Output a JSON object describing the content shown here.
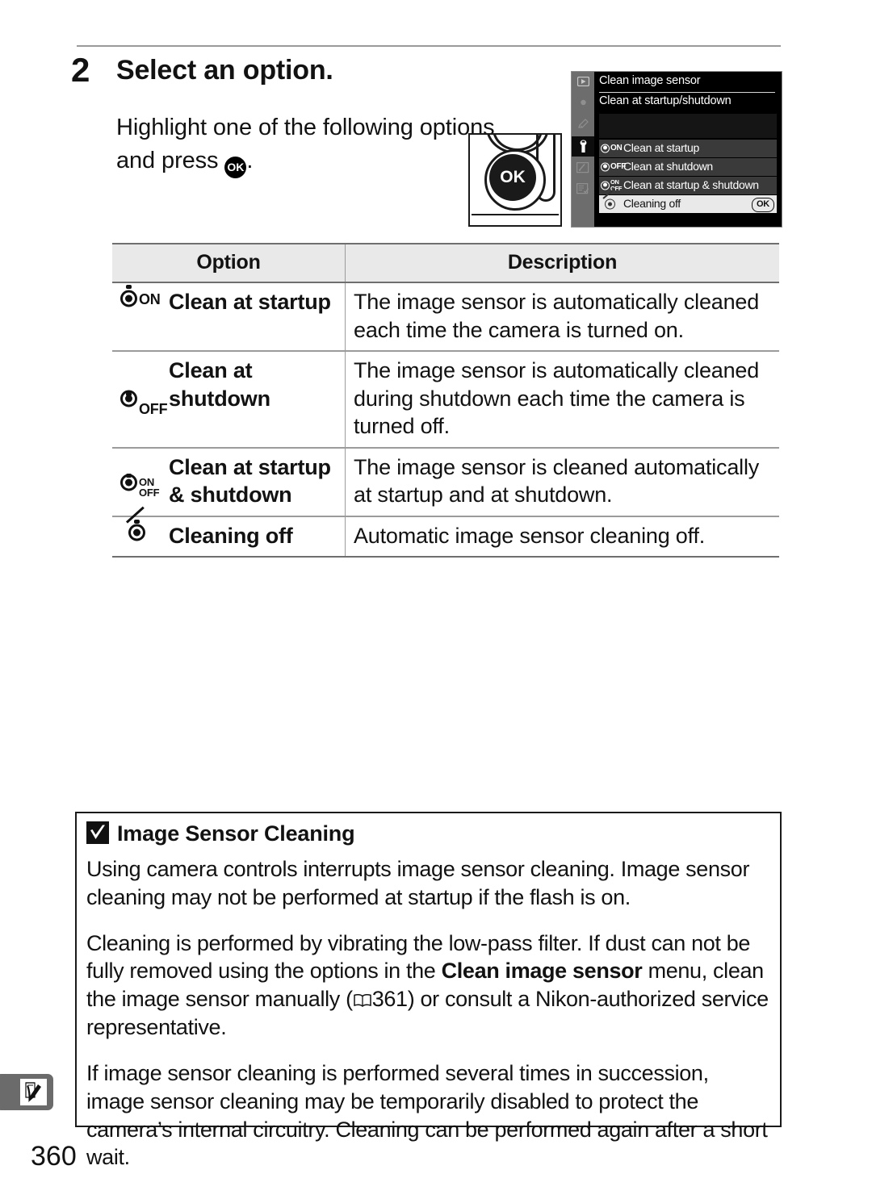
{
  "page": {
    "number": "360",
    "side_tab_icon": "setup-menu-pencil-icon"
  },
  "step": {
    "number": "2",
    "title": "Select an option.",
    "body_before": "Highlight one of the following options and press ",
    "body_icon": "ok-button-icon",
    "body_after": "."
  },
  "camera_illustration": {
    "button_label": "OK",
    "icon_name": "camera-multi-selector-ok-button"
  },
  "lcd": {
    "title": "Clean image sensor",
    "subtitle": "Clean at startup/shutdown",
    "sidebar_icons": [
      "playback-menu-icon",
      "shooting-menu-icon",
      "custom-settings-pencil-icon",
      "setup-menu-wrench-icon",
      "retouch-menu-icon",
      "recent-settings-icon"
    ],
    "sidebar_active_index": 3,
    "rows": [
      {
        "icon": "clean-at-startup-icon",
        "icon_text": "ON",
        "label": "Clean at startup",
        "highlighted": false,
        "badge": ""
      },
      {
        "icon": "clean-at-shutdown-icon",
        "icon_text": "OFF",
        "label": "Clean at shutdown",
        "highlighted": false,
        "badge": ""
      },
      {
        "icon": "clean-at-startup-and-shutdown-icon",
        "icon_text": "ON/OFF",
        "label": "Clean at startup & shutdown",
        "highlighted": false,
        "badge": ""
      },
      {
        "icon": "cleaning-off-icon",
        "icon_text": "",
        "label": "Cleaning off",
        "highlighted": true,
        "badge": "OK"
      }
    ]
  },
  "option_table": {
    "headers": {
      "option": "Option",
      "description": "Description"
    },
    "rows": [
      {
        "icon": "clean-at-startup-icon",
        "icon_text": "ON",
        "option": "Clean at startup",
        "description": "The image sensor is automatically cleaned each time the camera is turned on."
      },
      {
        "icon": "clean-at-shutdown-icon",
        "icon_text": "OFF",
        "option": "Clean at shutdown",
        "description": "The image sensor is automatically cleaned during shutdown each time the camera is turned off."
      },
      {
        "icon": "clean-at-startup-and-shutdown-icon",
        "icon_text": "ON/OFF",
        "option": "Clean at startup & shutdown",
        "description": "The image sensor is cleaned automatically at startup and at shutdown."
      },
      {
        "icon": "cleaning-off-icon",
        "icon_text": "",
        "option": "Cleaning off",
        "description": "Automatic image sensor cleaning off."
      }
    ]
  },
  "note": {
    "icon": "caution-checkmark-icon",
    "title": "Image Sensor Cleaning",
    "paragraph1": "Using camera controls interrupts image sensor cleaning.  Image sensor cleaning may not be performed at startup if the flash is on.",
    "paragraph2_a": "Cleaning is performed by vibrating the low-pass filter.  If dust can not be fully removed using the options in the ",
    "paragraph2_bold": "Clean image sensor",
    "paragraph2_b": " menu, clean the image sensor manually (",
    "paragraph2_ref_icon": "book-reference-icon",
    "paragraph2_ref": "361",
    "paragraph2_c": ") or consult a Nikon-authorized service representative.",
    "paragraph3": "If image sensor cleaning is performed several times in succession, image sensor cleaning may be temporarily disabled to protect the camera’s internal circuitry.  Cleaning can be performed again after a short wait."
  }
}
